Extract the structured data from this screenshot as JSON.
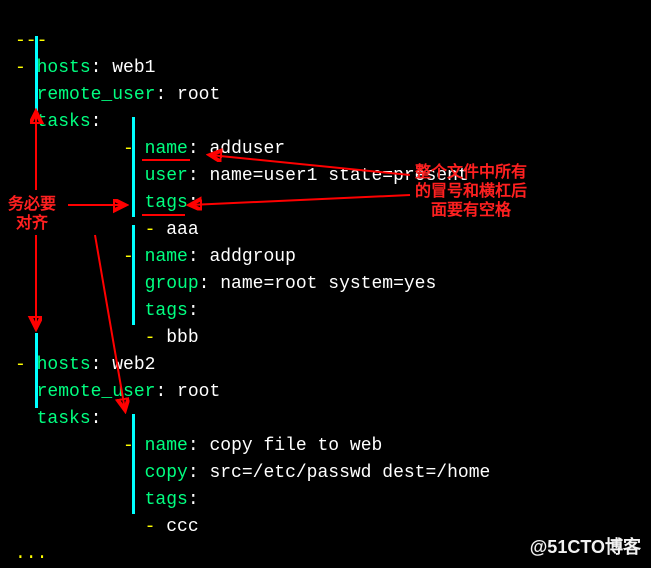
{
  "doc_start": "---",
  "doc_end": "...",
  "plays": [
    {
      "hosts_key": "hosts",
      "hosts_val": "web1",
      "remote_user_key": "remote_user",
      "remote_user_val": "root",
      "tasks_key": "tasks",
      "tasks": [
        {
          "name_key": "name",
          "name_val": "adduser",
          "mod_key": "user",
          "mod_val": "name=user1 state=present",
          "tags_key": "tags",
          "tag_item": "aaa"
        },
        {
          "name_key": "name",
          "name_val": "addgroup",
          "mod_key": "group",
          "mod_val": "name=root system=yes",
          "tags_key": "tags",
          "tag_item": "bbb"
        }
      ]
    },
    {
      "hosts_key": "hosts",
      "hosts_val": "web2",
      "remote_user_key": "remote_user",
      "remote_user_val": "root",
      "tasks_key": "tasks",
      "tasks": [
        {
          "name_key": "name",
          "name_val": "copy file to web",
          "mod_key": "copy",
          "mod_val": "src=/etc/passwd dest=/home",
          "tags_key": "tags",
          "tag_item": "ccc"
        }
      ]
    }
  ],
  "annotations": {
    "left_l1": "务必要",
    "left_l2": "对齐",
    "right_l1": "整个文件中所有",
    "right_l2": "的冒号和横杠后",
    "right_l3": "面要有空格"
  },
  "watermark": "@51CTO博客"
}
